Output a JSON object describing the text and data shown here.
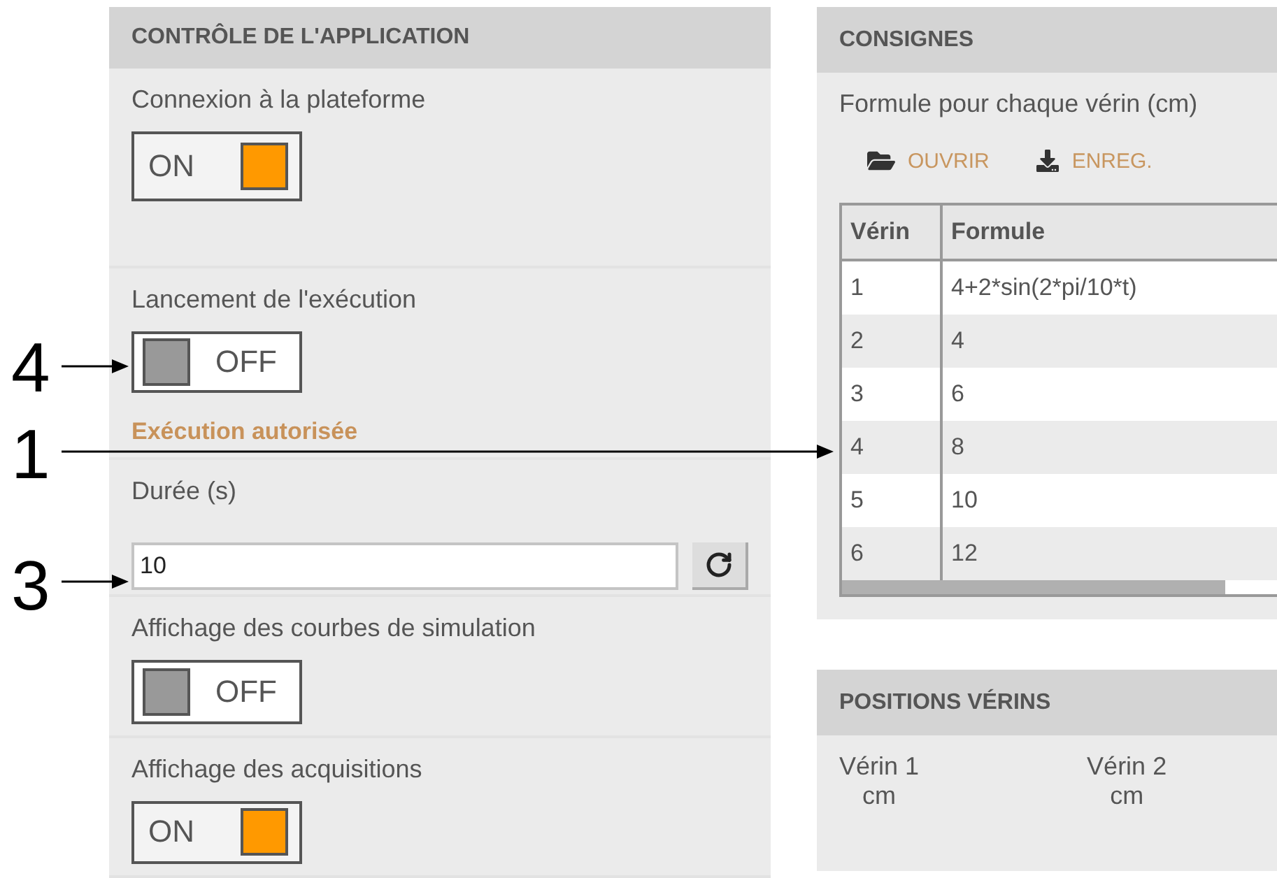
{
  "callouts": [
    {
      "label": "4",
      "kind": "short"
    },
    {
      "label": "1",
      "kind": "long"
    },
    {
      "label": "3",
      "kind": "short"
    }
  ],
  "control_panel": {
    "title": "CONTRÔLE DE L'APPLICATION",
    "settings": [
      {
        "kind": "toggle",
        "label": "Connexion à la plateforme",
        "on": true,
        "state_text": "ON"
      },
      {
        "kind": "toggle",
        "label": "Lancement de l'exécution",
        "on": false,
        "state_text": "OFF",
        "status": "Exécution autorisée"
      },
      {
        "kind": "number",
        "label": "Durée (s)",
        "value": "10"
      },
      {
        "kind": "toggle",
        "label": "Affichage des courbes de simulation",
        "on": false,
        "state_text": "OFF"
      },
      {
        "kind": "toggle",
        "label": "Affichage des acquisitions",
        "on": true,
        "state_text": "ON"
      }
    ]
  },
  "instructions_panel": {
    "title": "CONSIGNES",
    "description": "Formule pour chaque vérin (cm)",
    "actions": [
      {
        "kind": "open",
        "label": "OUVRIR"
      },
      {
        "kind": "save",
        "label": "ENREG."
      }
    ],
    "table": {
      "columns": [
        "Vérin",
        "Formule"
      ],
      "rows": [
        [
          "1",
          "4+2*sin(2*pi/10*t)"
        ],
        [
          "2",
          "4"
        ],
        [
          "3",
          "6"
        ],
        [
          "4",
          "8"
        ],
        [
          "5",
          "10"
        ],
        [
          "6",
          "12"
        ]
      ]
    }
  },
  "positions_panel": {
    "title": "POSITIONS VÉRINS",
    "items": [
      {
        "name": "Vérin 1",
        "unit": "cm"
      },
      {
        "name": "Vérin 2",
        "unit": "cm"
      }
    ]
  }
}
